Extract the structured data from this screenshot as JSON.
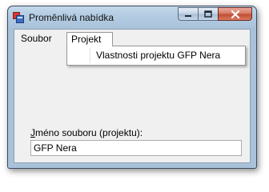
{
  "window": {
    "title": "Proměnlivá nabídka",
    "caption_buttons": {
      "minimize": "minimize-icon",
      "maximize": "maximize-icon",
      "close": "close-icon"
    }
  },
  "menubar": {
    "items": [
      {
        "label": "Soubor"
      },
      {
        "label": "Projekt",
        "open": true
      }
    ]
  },
  "dropdown": {
    "items": [
      {
        "label": "Vlastnosti projektu GFP Nera"
      }
    ]
  },
  "form": {
    "label_accel": "J",
    "label_rest": "méno souboru (projektu):",
    "value": "GFP Nera"
  },
  "colors": {
    "accent": "#a9c2da",
    "close": "#c14a31"
  }
}
